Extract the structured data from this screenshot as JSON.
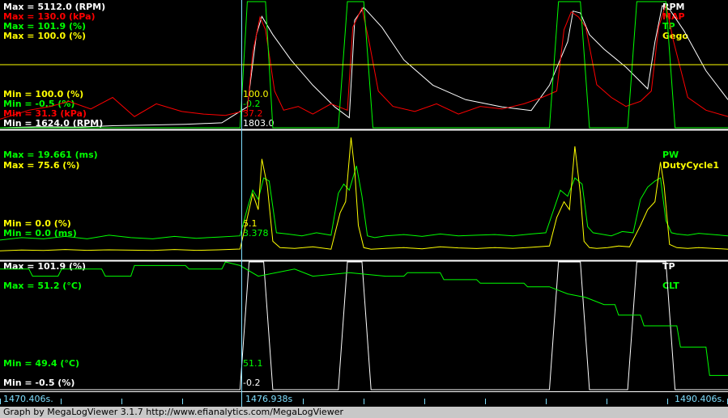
{
  "colors": {
    "rpm": "#ffffff",
    "map": "#ff0000",
    "tp": "#00ff00",
    "gego": "#ffff00",
    "pw": "#00ff00",
    "dutycycle": "#ffff00",
    "tp3": "#ffffff",
    "clt": "#00ff00",
    "axis": "#7fdfff",
    "background": "#000000"
  },
  "cursor": {
    "time": "1476.938s"
  },
  "time_axis": {
    "start": "1470.406s.",
    "cursor": "1476.938s",
    "end": "1490.406s."
  },
  "footer": {
    "credit": "Graph by MegaLogViewer 3.1.7 http://www.efianalytics.com/MegaLogViewer"
  },
  "chart_data": [
    {
      "type": "line",
      "panel": 1,
      "x_range": [
        1470.406,
        1490.406
      ],
      "series": [
        {
          "name": "RPM",
          "unit": "RPM",
          "max_label": "Max = 5112.0 (RPM)",
          "min_label": "Min = 1624.0 (RPM)",
          "cursor_value": "1803.0",
          "ylim": [
            1624.0,
            5112.0
          ],
          "x": [
            1470.406,
            1471.5,
            1472.5,
            1473.5,
            1474.5,
            1475.5,
            1476.5,
            1477.2,
            1477.45,
            1477.6,
            1477.9,
            1478.4,
            1479.0,
            1479.6,
            1480.0,
            1480.15,
            1480.4,
            1480.9,
            1481.5,
            1482.3,
            1483.2,
            1484.2,
            1485.0,
            1485.5,
            1486.0,
            1486.15,
            1486.35,
            1486.6,
            1487.0,
            1487.6,
            1488.2,
            1488.4,
            1488.6,
            1488.8,
            1489.2,
            1489.8,
            1490.406
          ],
          "y": [
            1624,
            1650,
            1640,
            1680,
            1700,
            1720,
            1760,
            2200,
            4200,
            4700,
            4200,
            3500,
            2800,
            2200,
            1900,
            4600,
            4950,
            4400,
            3500,
            2800,
            2400,
            2200,
            2100,
            2800,
            4000,
            4850,
            4800,
            4200,
            3800,
            3300,
            2700,
            4000,
            5000,
            4900,
            4300,
            3200,
            2400
          ]
        },
        {
          "name": "MAP",
          "unit": "kPa",
          "max_label": "Max = 130.0 (kPa)",
          "min_label": "Min = 31.3 (kPa)",
          "cursor_value": "37.2",
          "ylim": [
            31.3,
            130.0
          ],
          "x": [
            1470.406,
            1471.2,
            1471.8,
            1472.3,
            1472.9,
            1473.5,
            1474.1,
            1474.7,
            1475.4,
            1476.0,
            1476.6,
            1477.2,
            1477.35,
            1477.55,
            1477.7,
            1477.95,
            1478.2,
            1478.6,
            1479.0,
            1479.5,
            1479.95,
            1480.1,
            1480.35,
            1480.55,
            1480.8,
            1481.2,
            1481.8,
            1482.4,
            1483.0,
            1483.6,
            1484.2,
            1484.8,
            1485.3,
            1485.7,
            1485.9,
            1486.1,
            1486.3,
            1486.5,
            1486.8,
            1487.2,
            1487.6,
            1488.0,
            1488.3,
            1488.5,
            1488.7,
            1488.9,
            1489.3,
            1489.8,
            1490.406
          ],
          "y": [
            38,
            45,
            48,
            52,
            46,
            55,
            40,
            50,
            44,
            42,
            41,
            45,
            90,
            118,
            108,
            60,
            45,
            48,
            42,
            50,
            45,
            110,
            125,
            98,
            60,
            48,
            44,
            50,
            42,
            48,
            46,
            50,
            55,
            60,
            108,
            122,
            118,
            110,
            65,
            55,
            48,
            52,
            60,
            110,
            128,
            100,
            55,
            45,
            40
          ]
        },
        {
          "name": "TP",
          "unit": "%",
          "max_label": "Max = 101.9 (%)",
          "min_label": "Min = -0.5 (%)",
          "cursor_value": "-0.2",
          "ylim": [
            -0.5,
            101.9
          ],
          "x": [
            1470.406,
            1477.0,
            1477.2,
            1477.7,
            1477.9,
            1479.7,
            1479.95,
            1480.4,
            1480.65,
            1485.5,
            1485.75,
            1486.35,
            1486.6,
            1487.65,
            1487.9,
            1488.7,
            1488.95,
            1490.406
          ],
          "y": [
            -0.5,
            -0.5,
            101.9,
            101.9,
            -0.5,
            -0.5,
            101.9,
            101.9,
            -0.5,
            -0.5,
            101.9,
            101.9,
            -0.5,
            -0.5,
            101.9,
            101.9,
            -0.5,
            -0.5
          ]
        },
        {
          "name": "Gego",
          "unit": "%",
          "max_label": "Max = 100.0 (%)",
          "min_label": "Min = 100.0 (%)",
          "cursor_value": "100.0",
          "ylim": [
            100.0,
            100.0
          ],
          "x": [
            1470.406,
            1490.406
          ],
          "y": [
            100.0,
            100.0
          ]
        }
      ]
    },
    {
      "type": "line",
      "panel": 2,
      "x_range": [
        1470.406,
        1490.406
      ],
      "series": [
        {
          "name": "PW",
          "unit": "ms",
          "max_label": "Max = 19.661 (ms)",
          "min_label": "Min = 0.0 (ms)",
          "cursor_value": "3.378",
          "ylim": [
            0.0,
            19.661
          ],
          "x": [
            1470.406,
            1471.0,
            1471.6,
            1472.2,
            1472.8,
            1473.4,
            1474.0,
            1474.6,
            1475.2,
            1475.8,
            1476.4,
            1477.0,
            1477.2,
            1477.35,
            1477.5,
            1477.65,
            1477.8,
            1478.0,
            1478.3,
            1478.7,
            1479.1,
            1479.5,
            1479.7,
            1479.85,
            1480.0,
            1480.2,
            1480.35,
            1480.5,
            1480.7,
            1481.0,
            1481.5,
            1482.0,
            1482.5,
            1483.0,
            1483.5,
            1484.0,
            1484.5,
            1485.0,
            1485.4,
            1485.6,
            1485.8,
            1486.0,
            1486.2,
            1486.4,
            1486.55,
            1486.7,
            1486.9,
            1487.2,
            1487.5,
            1487.8,
            1488.0,
            1488.2,
            1488.4,
            1488.55,
            1488.7,
            1488.85,
            1489.0,
            1489.3,
            1489.6,
            1490.0,
            1490.406
          ],
          "y": [
            2.8,
            3.2,
            3.0,
            3.4,
            3.0,
            3.6,
            3.2,
            3.0,
            3.4,
            3.1,
            3.3,
            3.5,
            8.0,
            11.0,
            9.5,
            13.0,
            12.5,
            4.0,
            3.8,
            3.5,
            4.0,
            3.6,
            10.5,
            12.0,
            11.0,
            15.0,
            10.0,
            3.5,
            3.2,
            3.5,
            3.7,
            3.4,
            3.8,
            3.5,
            3.6,
            3.7,
            3.5,
            3.8,
            4.0,
            7.5,
            11.0,
            10.0,
            13.0,
            12.0,
            5.0,
            4.0,
            3.8,
            3.5,
            4.2,
            4.0,
            9.5,
            11.5,
            12.5,
            13.0,
            6.0,
            4.0,
            3.8,
            3.6,
            3.9,
            3.7,
            3.5
          ]
        },
        {
          "name": "DutyCycle1",
          "unit": "%",
          "max_label": "Max = 75.6 (%)",
          "min_label": "Min = 0.0 (%)",
          "cursor_value": "5.1",
          "ylim": [
            0.0,
            75.6
          ],
          "x": [
            1470.406,
            1471.0,
            1471.6,
            1472.2,
            1472.8,
            1473.4,
            1474.0,
            1474.6,
            1475.2,
            1475.8,
            1476.4,
            1477.0,
            1477.2,
            1477.35,
            1477.5,
            1477.6,
            1477.75,
            1477.9,
            1478.1,
            1478.5,
            1479.0,
            1479.5,
            1479.75,
            1479.9,
            1480.05,
            1480.15,
            1480.25,
            1480.4,
            1480.6,
            1481.0,
            1481.5,
            1482.0,
            1482.5,
            1483.0,
            1483.5,
            1484.0,
            1484.5,
            1485.0,
            1485.5,
            1485.7,
            1485.9,
            1486.05,
            1486.2,
            1486.35,
            1486.45,
            1486.6,
            1486.8,
            1487.1,
            1487.4,
            1487.7,
            1488.0,
            1488.2,
            1488.4,
            1488.55,
            1488.65,
            1488.8,
            1489.0,
            1489.3,
            1489.6,
            1490.0,
            1490.406
          ],
          "y": [
            4.0,
            4.5,
            4.2,
            4.8,
            4.3,
            4.6,
            4.4,
            4.2,
            4.8,
            4.3,
            4.6,
            5.1,
            25.0,
            40.0,
            30.0,
            62.0,
            45.0,
            10.0,
            6.0,
            5.5,
            6.5,
            5.0,
            28.0,
            35.0,
            75.6,
            55.0,
            20.0,
            6.0,
            5.0,
            5.5,
            6.0,
            5.2,
            6.5,
            5.8,
            5.4,
            6.0,
            5.5,
            6.2,
            7.0,
            25.0,
            35.0,
            30.0,
            70.0,
            40.0,
            10.0,
            6.0,
            5.5,
            6.0,
            7.0,
            6.5,
            20.0,
            30.0,
            35.0,
            60.0,
            45.0,
            8.0,
            6.0,
            5.5,
            6.0,
            5.5,
            5.0
          ]
        }
      ]
    },
    {
      "type": "line",
      "panel": 3,
      "x_range": [
        1470.406,
        1490.406
      ],
      "series": [
        {
          "name": "TP",
          "unit": "%",
          "max_label": "Max = 101.9 (%)",
          "min_label": "Min = -0.5 (%)",
          "cursor_value": "-0.2",
          "ylim": [
            -0.5,
            101.9
          ],
          "x": [
            1470.406,
            1477.0,
            1477.25,
            1477.65,
            1477.9,
            1479.7,
            1479.95,
            1480.35,
            1480.6,
            1485.5,
            1485.75,
            1486.35,
            1486.6,
            1487.65,
            1487.9,
            1488.7,
            1488.95,
            1490.406
          ],
          "y": [
            -0.5,
            -0.5,
            101.9,
            101.9,
            -0.5,
            -0.5,
            101.9,
            101.9,
            -0.5,
            -0.5,
            101.9,
            101.9,
            -0.5,
            -0.5,
            101.9,
            101.9,
            -0.5,
            -0.5
          ]
        },
        {
          "name": "CLT",
          "unit": "°C",
          "max_label": "Max = 51.2 (°C)",
          "min_label": "Min = 49.4 (°C)",
          "cursor_value": "51.1",
          "ylim": [
            49.4,
            51.2
          ],
          "x": [
            1470.406,
            1471.2,
            1471.3,
            1472.0,
            1472.1,
            1473.2,
            1473.3,
            1474.0,
            1474.1,
            1475.5,
            1475.6,
            1476.5,
            1476.6,
            1477.0,
            1477.5,
            1478.5,
            1479.0,
            1480.0,
            1481.0,
            1481.5,
            1481.6,
            1482.5,
            1482.6,
            1483.5,
            1483.6,
            1484.8,
            1484.9,
            1485.5,
            1486.0,
            1486.5,
            1487.0,
            1487.3,
            1487.4,
            1488.0,
            1488.1,
            1489.0,
            1489.1,
            1489.8,
            1489.9,
            1490.406
          ],
          "y": [
            51.1,
            51.1,
            51.0,
            51.0,
            51.1,
            51.1,
            51.0,
            51.0,
            51.15,
            51.15,
            51.1,
            51.1,
            51.2,
            51.15,
            51.0,
            51.1,
            51.0,
            51.05,
            51.0,
            51.0,
            51.05,
            51.05,
            50.95,
            50.95,
            50.9,
            50.9,
            50.85,
            50.85,
            50.75,
            50.7,
            50.6,
            50.6,
            50.45,
            50.45,
            50.3,
            50.3,
            50.0,
            50.0,
            49.6,
            49.6
          ]
        }
      ]
    }
  ]
}
